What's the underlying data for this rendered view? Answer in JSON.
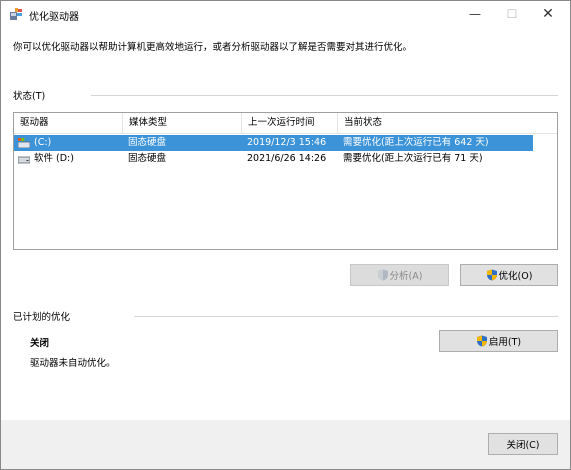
{
  "window": {
    "title": "优化驱动器",
    "minimize_glyph": "—",
    "maximize_glyph": "☐",
    "close_glyph": "✕"
  },
  "description": "你可以优化驱动器以帮助计算机更高效地运行，或者分析驱动器以了解是否需要对其进行优化。",
  "status": {
    "label": "状态(T)",
    "columns": [
      "驱动器",
      "媒体类型",
      "上一次运行时间",
      "当前状态"
    ],
    "rows": [
      {
        "drive": "(C:)",
        "media": "固态硬盘",
        "last_run": "2019/12/3 15:46",
        "state": "需要优化(距上次运行已有 642 天)",
        "selected": true,
        "icon": "system-drive-icon"
      },
      {
        "drive": "软件 (D:)",
        "media": "固态硬盘",
        "last_run": "2021/6/26 14:26",
        "state": "需要优化(距上次运行已有 71 天)",
        "selected": false,
        "icon": "drive-icon"
      }
    ],
    "analyze_label": "分析(A)",
    "optimize_label": "优化(O)"
  },
  "scheduled": {
    "label": "已计划的优化",
    "status": "关闭",
    "description": "驱动器未自动优化。",
    "enable_label": "启用(T)"
  },
  "footer": {
    "close_label": "关闭(C)"
  },
  "colors": {
    "selection": "#3c93d8",
    "accent": "#0078d7"
  }
}
